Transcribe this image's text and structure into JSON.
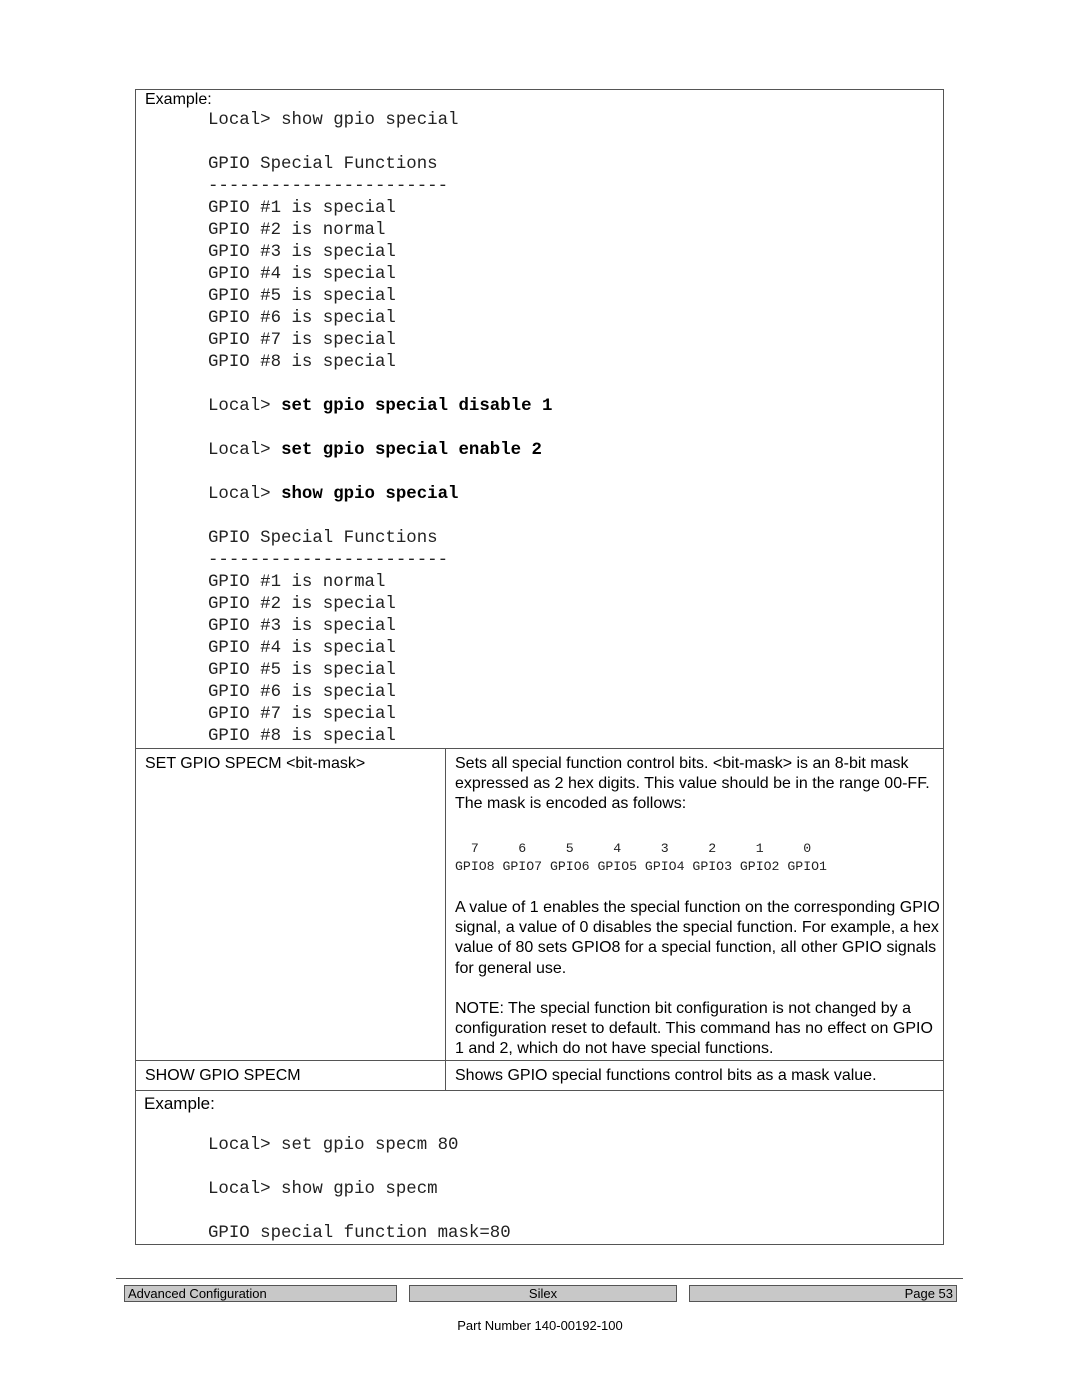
{
  "example1": {
    "label": "Example:",
    "lines": [
      {
        "prompt": "Local> ",
        "cmd": "show gpio special",
        "bold": false
      },
      {
        "text": "GPIO Special Functions"
      },
      {
        "text": "-----------------------"
      },
      {
        "text": "GPIO #1 is special"
      },
      {
        "text": "GPIO #2 is normal"
      },
      {
        "text": "GPIO #3 is special"
      },
      {
        "text": "GPIO #4 is special"
      },
      {
        "text": "GPIO #5 is special"
      },
      {
        "text": "GPIO #6 is special"
      },
      {
        "text": "GPIO #7 is special"
      },
      {
        "text": "GPIO #8 is special"
      },
      {
        "prompt": "Local> ",
        "cmd": "set gpio special disable 1",
        "bold": true
      },
      {
        "prompt": "Local> ",
        "cmd": "set gpio special enable 2",
        "bold": true
      },
      {
        "prompt": "Local> ",
        "cmd": "show gpio special",
        "bold": true
      },
      {
        "text": "GPIO Special Functions"
      },
      {
        "text": "-----------------------"
      },
      {
        "text": "GPIO #1 is normal"
      },
      {
        "text": "GPIO #2 is special"
      },
      {
        "text": "GPIO #3 is special"
      },
      {
        "text": "GPIO #4 is special"
      },
      {
        "text": "GPIO #5 is special"
      },
      {
        "text": "GPIO #6 is special"
      },
      {
        "text": "GPIO #7 is special"
      },
      {
        "text": "GPIO #8 is special"
      }
    ]
  },
  "set_specm": {
    "command": "SET GPIO SPECM <bit-mask>",
    "desc1": "Sets all special function control bits.  <bit-mask> is an 8-bit mask expressed as 2 hex digits.  This value should be in the range 00-FF.  The mask is encoded as follows:",
    "bits": [
      "7",
      "6",
      "5",
      "4",
      "3",
      "2",
      "1",
      "0"
    ],
    "gpios": [
      "GPIO8",
      "GPIO7",
      "GPIO6",
      "GPIO5",
      "GPIO4",
      "GPIO3",
      "GPIO2",
      "GPIO1"
    ],
    "desc2": "A value of 1 enables the special function on the corresponding GPIO signal, a value of 0 disables the special function.  For example, a hex value of 80 sets GPIO8 for a special function, all other GPIO signals for general use.",
    "note": "NOTE:  The special function bit configuration is not changed by a configuration reset to default.  This command has no effect on GPIO 1 and 2, which do not have special functions."
  },
  "show_specm": {
    "command": "SHOW GPIO SPECM",
    "desc": "Shows GPIO special functions control bits as a mask value."
  },
  "example2": {
    "label": "Example:",
    "line1": "Local> set gpio specm 80",
    "line2": "Local> show gpio specm",
    "line3": "GPIO special function mask=80"
  },
  "footer": {
    "section": "Advanced Configuration",
    "company": "Silex",
    "page": "Page 53",
    "part_number": "Part Number 140-00192-100"
  }
}
